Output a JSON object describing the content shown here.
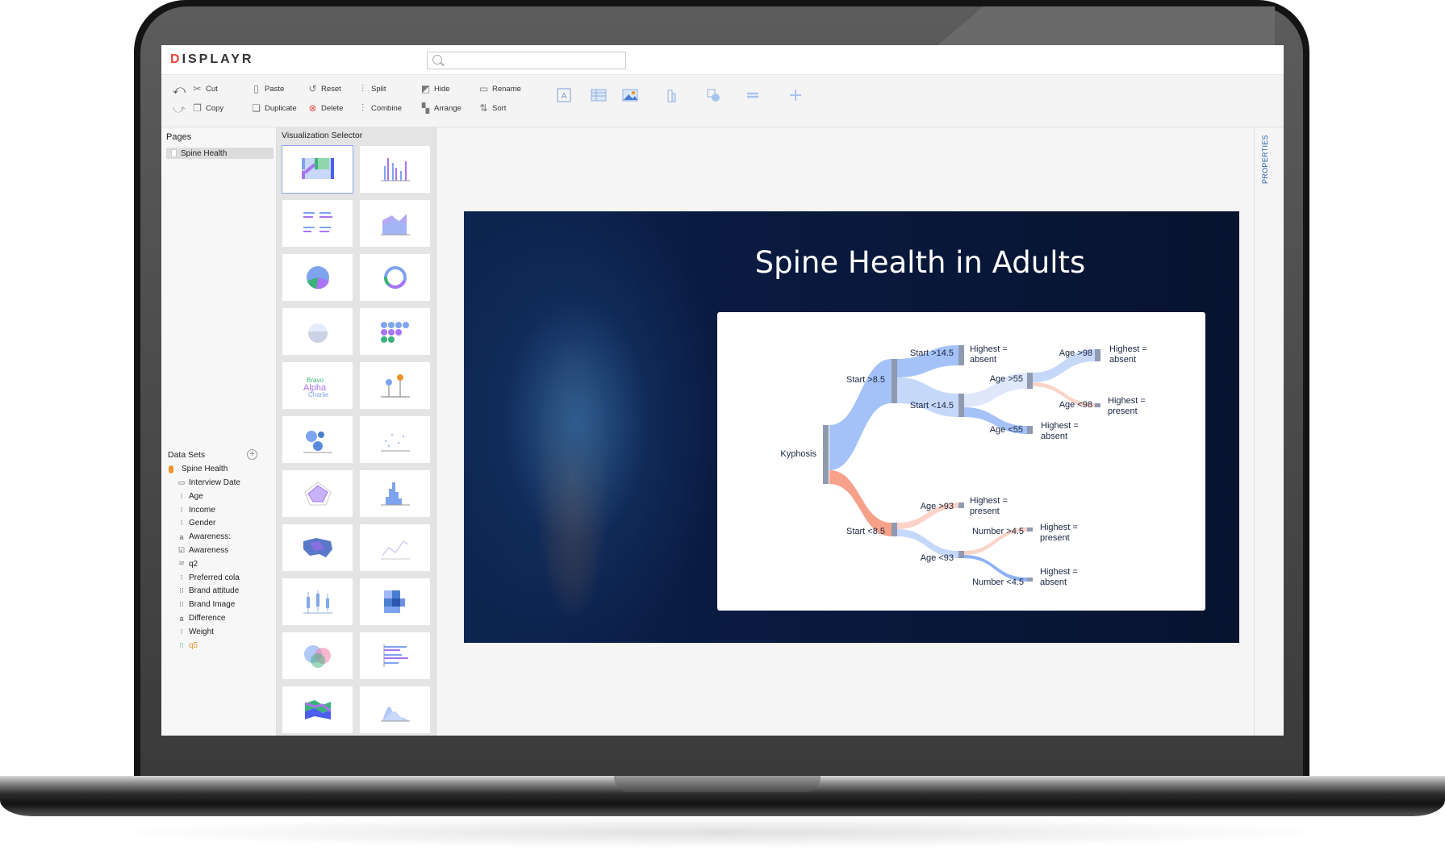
{
  "app": {
    "logo": "DISPLAYR",
    "search": {
      "placeholder": ""
    }
  },
  "toolbar": {
    "row1": [
      {
        "label": "Cut",
        "icon": "cut-icon",
        "glyph": "✂"
      },
      {
        "label": "Paste",
        "icon": "paste-icon",
        "glyph": "▯"
      },
      {
        "label": "Reset",
        "icon": "reset-icon",
        "glyph": "↺"
      },
      {
        "label": "Split",
        "icon": "split-icon",
        "glyph": "⫶"
      },
      {
        "label": "Hide",
        "icon": "hide-icon",
        "glyph": "◩"
      },
      {
        "label": "Rename",
        "icon": "rename-icon",
        "glyph": "▭"
      }
    ],
    "row2": [
      {
        "label": "Copy",
        "icon": "copy-icon",
        "glyph": "❐"
      },
      {
        "label": "Duplicate",
        "icon": "duplicate-icon",
        "glyph": "❏"
      },
      {
        "label": "Delete",
        "icon": "delete-icon",
        "glyph": "⊗"
      },
      {
        "label": "Combine",
        "icon": "combine-icon",
        "glyph": "⫶"
      },
      {
        "label": "Arrange",
        "icon": "arrange-icon",
        "glyph": "▚"
      },
      {
        "label": "Sort",
        "icon": "sort-az-icon",
        "glyph": "⇅"
      }
    ],
    "insert_icons": [
      "text-box-icon",
      "table-icon",
      "image-icon",
      "chart-icon",
      "shape-icon",
      "line-icon",
      "plus-icon"
    ]
  },
  "pages": {
    "heading": "Pages",
    "items": [
      {
        "label": "Spine Health",
        "selected": true
      }
    ]
  },
  "datasets": {
    "heading": "Data Sets",
    "root": "Spine Health",
    "items": [
      {
        "label": "Interview Date",
        "icon": "date-icon",
        "glyph": "▭"
      },
      {
        "label": "Age",
        "icon": "single-select-icon",
        "glyph": "⁝"
      },
      {
        "label": "Income",
        "icon": "single-select-icon",
        "glyph": "⁝"
      },
      {
        "label": "Gender",
        "icon": "single-select-icon",
        "glyph": "⁝"
      },
      {
        "label": "Awareness:",
        "icon": "text-icon",
        "glyph": "a"
      },
      {
        "label": "Awareness",
        "icon": "multi-select-icon",
        "glyph": "☑"
      },
      {
        "label": "q2",
        "icon": "numeric-grid-icon",
        "glyph": "²²"
      },
      {
        "label": "Preferred cola",
        "icon": "single-select-icon",
        "glyph": "⁝"
      },
      {
        "label": "Brand attitude",
        "icon": "grid-icon",
        "glyph": "⁝⁝"
      },
      {
        "label": "Brand Image",
        "icon": "grid-icon",
        "glyph": "⁝⁝"
      },
      {
        "label": "Difference",
        "icon": "text-icon",
        "glyph": "a"
      },
      {
        "label": "Weight",
        "icon": "single-select-icon",
        "glyph": "⁝"
      },
      {
        "label": "q5",
        "icon": "grid-icon",
        "glyph": "⁝⁝",
        "highlight": "#f0932b"
      }
    ]
  },
  "viz_selector": {
    "heading": "Visualization Selector",
    "items": [
      "sankey",
      "column",
      "small-multiples-bar",
      "area",
      "pie",
      "donut",
      "pictograph",
      "dot-pictograph",
      "word-cloud",
      "palm-tree",
      "bubble",
      "scatter",
      "radar",
      "histogram",
      "geographic-map",
      "line",
      "box-plot",
      "heatmap",
      "venn",
      "bar",
      "streamgraph",
      "density"
    ],
    "selected": "sankey"
  },
  "properties": {
    "label": "PROPERTIES"
  },
  "slide": {
    "title": "Spine Health in Adults",
    "chart": {
      "nodes": [
        "Kyphosis",
        "Start >8.5",
        "Start <8.5",
        "Start >14.5",
        "Start <14.5",
        "Age >55",
        "Age <55",
        "Age >98",
        "Age <98",
        "Age >93",
        "Age <93",
        "Number >4.5",
        "Number <4.5"
      ],
      "leaf_labels": [
        [
          "Highest =",
          "absent"
        ],
        [
          "Highest =",
          "absent"
        ],
        [
          "Highest =",
          "present"
        ],
        [
          "Highest =",
          "absent"
        ],
        [
          "Highest =",
          "present"
        ],
        [
          "Highest =",
          "present"
        ],
        [
          "Highest =",
          "absent"
        ]
      ]
    }
  },
  "colors": {
    "accent": "#2a5ea8",
    "link_absent": "#a4c2f7",
    "link_present": "#f7a08a",
    "node": "#8f9ab0",
    "slide_bg": "#0a1b42"
  }
}
